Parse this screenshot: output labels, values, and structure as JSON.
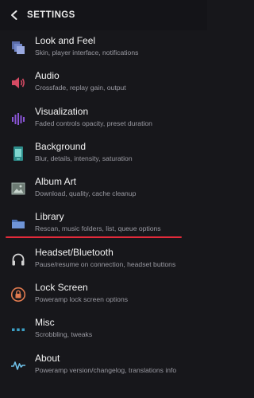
{
  "header": {
    "title": "SETTINGS"
  },
  "items": [
    {
      "title": "Look and Feel",
      "subtitle": "Skin, player interface, notifications",
      "icon": "look-and-feel-icon"
    },
    {
      "title": "Audio",
      "subtitle": "Crossfade, replay gain, output",
      "icon": "audio-icon"
    },
    {
      "title": "Visualization",
      "subtitle": "Faded controls opacity, preset duration",
      "icon": "visualization-icon"
    },
    {
      "title": "Background",
      "subtitle": "Blur, details, intensity, saturation",
      "icon": "background-icon"
    },
    {
      "title": "Album Art",
      "subtitle": "Download, quality, cache cleanup",
      "icon": "album-art-icon"
    },
    {
      "title": "Library",
      "subtitle": "Rescan, music folders, list, queue options",
      "icon": "folder-icon"
    },
    {
      "title": "Headset/Bluetooth",
      "subtitle": "Pause/resume on connection, headset buttons",
      "icon": "headphones-icon"
    },
    {
      "title": "Lock Screen",
      "subtitle": "Poweramp lock screen options",
      "icon": "lock-icon"
    },
    {
      "title": "Misc",
      "subtitle": "Scrobbling, tweaks",
      "icon": "misc-dots-icon"
    },
    {
      "title": "About",
      "subtitle": "Poweramp version/changelog, translations info",
      "icon": "about-wave-icon"
    }
  ],
  "colors": {
    "accent": "#e22a3a",
    "background": "#17171b"
  }
}
